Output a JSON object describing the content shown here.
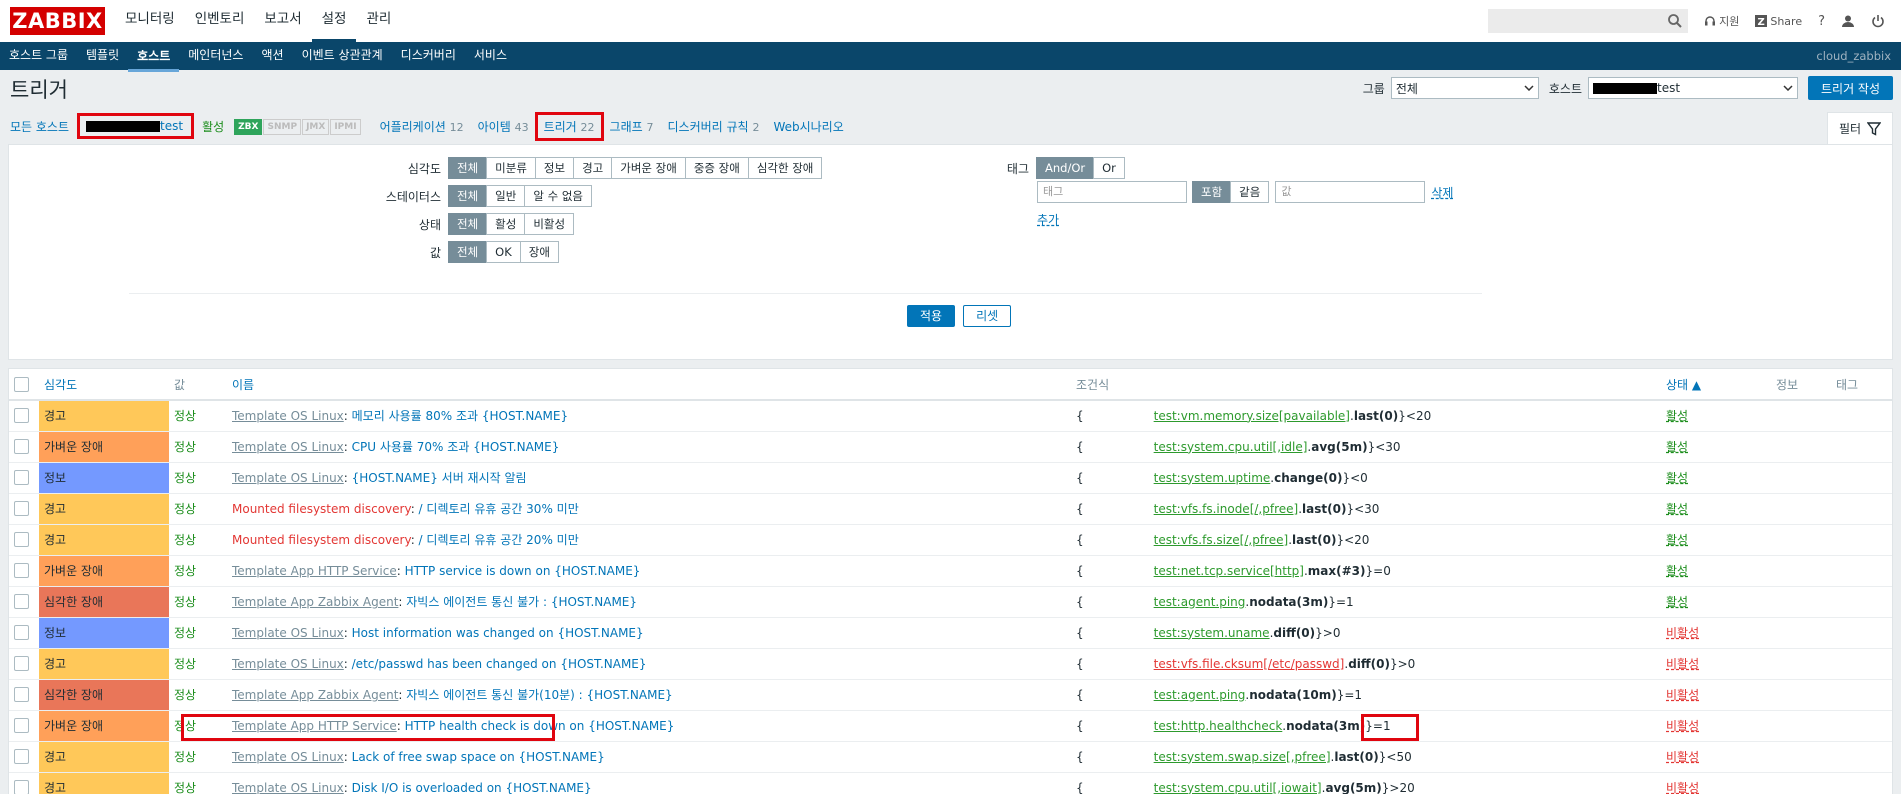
{
  "brand": {
    "logo_text": "ZABBIX",
    "color": "#d40000"
  },
  "main_menu": [
    "모니터링",
    "인벤토리",
    "보고서",
    "설정",
    "관리"
  ],
  "main_menu_active": "설정",
  "top_right": {
    "support": "지원",
    "share": "Share",
    "help": "?"
  },
  "sub_menu": [
    "호스트 그룹",
    "템플릿",
    "호스트",
    "메인터넌스",
    "액션",
    "이벤트 상관관계",
    "디스커버리",
    "서비스"
  ],
  "sub_menu_active": "호스트",
  "server_name": "cloud_zabbix",
  "page_title": "트리거",
  "header": {
    "group_label": "그룹",
    "group_value": "전체",
    "host_label": "호스트",
    "host_value_suffix": "test",
    "create_button": "트리거 작성"
  },
  "host_nav": {
    "all_hosts": "모든 호스트",
    "host_suffix": "test",
    "status": "활성",
    "interfaces": [
      "ZBX",
      "SNMP",
      "JMX",
      "IPMI"
    ],
    "apps": {
      "label": "어플리케이션",
      "count": "12"
    },
    "items": {
      "label": "아이템",
      "count": "43"
    },
    "triggers": {
      "label": "트리거",
      "count": "22"
    },
    "graphs": {
      "label": "그래프",
      "count": "7"
    },
    "discovery": {
      "label": "디스커버리 규칙",
      "count": "2"
    },
    "web": {
      "label": "Web시나리오"
    },
    "filter_tab": "필터"
  },
  "filter": {
    "severity_label": "심각도",
    "severity_options": [
      "전체",
      "미분류",
      "정보",
      "경고",
      "가벼운 장애",
      "중증 장애",
      "심각한 장애"
    ],
    "state_label": "스테이터스",
    "state_options": [
      "전체",
      "일반",
      "알 수 없음"
    ],
    "status_label": "상태",
    "status_options": [
      "전체",
      "활성",
      "비활성"
    ],
    "value_label": "값",
    "value_options": [
      "전체",
      "OK",
      "장애"
    ],
    "tags_label": "태그",
    "tags_ops": [
      "And/Or",
      "Or"
    ],
    "tag_placeholder": "태그",
    "tag_match": [
      "포함",
      "같음"
    ],
    "tag_value_placeholder": "값",
    "remove": "삭제",
    "add": "추가",
    "apply": "적용",
    "reset": "리셋"
  },
  "table": {
    "headers": {
      "severity": "심각도",
      "value": "값",
      "name": "이름",
      "expression": "조건식",
      "status": "상태 ▲",
      "info": "정보",
      "tags": "태그"
    },
    "rows": [
      {
        "sev": "경고",
        "cls": "s-warn",
        "value": "정상",
        "prefix": "Template OS Linux",
        "prefix_red": false,
        "name": "메모리 사용률 80% 조과 {HOST.NAME}",
        "exp_key": "test:vm.memory.size[pavailable]",
        "exp_fn": "last(0)",
        "exp_rest": "}<20",
        "exp_red": false,
        "status": "활성"
      },
      {
        "sev": "가벼운 장애",
        "cls": "s-avg",
        "value": "정상",
        "prefix": "Template OS Linux",
        "prefix_red": false,
        "name": "CPU 사용률 70% 조과 {HOST.NAME}",
        "exp_key": "test:system.cpu.util[,idle]",
        "exp_fn": "avg(5m)",
        "exp_rest": "}<30",
        "exp_red": false,
        "status": "활성"
      },
      {
        "sev": "정보",
        "cls": "s-info",
        "value": "정상",
        "prefix": "Template OS Linux",
        "prefix_red": false,
        "name": "{HOST.NAME} 서버 재시작 알림",
        "exp_key": "test:system.uptime",
        "exp_fn": "change(0)",
        "exp_rest": "}<0",
        "exp_red": false,
        "status": "활성"
      },
      {
        "sev": "경고",
        "cls": "s-warn",
        "value": "정상",
        "prefix": "Mounted filesystem discovery",
        "prefix_red": true,
        "name": "/ 디렉토리 유휴 공간 30% 미만",
        "exp_key": "test:vfs.fs.inode[/,pfree]",
        "exp_fn": "last(0)",
        "exp_rest": "}<30",
        "exp_red": false,
        "status": "활성"
      },
      {
        "sev": "경고",
        "cls": "s-warn",
        "value": "정상",
        "prefix": "Mounted filesystem discovery",
        "prefix_red": true,
        "name": "/ 디렉토리 유휴 공간 20% 미만",
        "exp_key": "test:vfs.fs.size[/,pfree]",
        "exp_fn": "last(0)",
        "exp_rest": "}<20",
        "exp_red": false,
        "status": "활성"
      },
      {
        "sev": "가벼운 장애",
        "cls": "s-avg",
        "value": "정상",
        "prefix": "Template App HTTP Service",
        "prefix_red": false,
        "name": "HTTP service is down on {HOST.NAME}",
        "exp_key": "test:net.tcp.service[http]",
        "exp_fn": "max(#3)",
        "exp_rest": "}=0",
        "exp_red": false,
        "status": "활성"
      },
      {
        "sev": "심각한 장애",
        "cls": "s-dis",
        "value": "정상",
        "prefix": "Template App Zabbix Agent",
        "prefix_red": false,
        "name": "자빅스 에이전트 통신 불가 : {HOST.NAME}",
        "exp_key": "test:agent.ping",
        "exp_fn": "nodata(3m)",
        "exp_rest": "}=1",
        "exp_red": false,
        "status": "활성"
      },
      {
        "sev": "정보",
        "cls": "s-info",
        "value": "정상",
        "prefix": "Template OS Linux",
        "prefix_red": false,
        "name": "Host information was changed on {HOST.NAME}",
        "exp_key": "test:system.uname",
        "exp_fn": "diff(0)",
        "exp_rest": "}>0",
        "exp_red": false,
        "status": "비활성"
      },
      {
        "sev": "경고",
        "cls": "s-warn",
        "value": "정상",
        "prefix": "Template OS Linux",
        "prefix_red": false,
        "name": "/etc/passwd has been changed on {HOST.NAME}",
        "exp_key": "test:vfs.file.cksum[/etc/passwd]",
        "exp_fn": "diff(0)",
        "exp_rest": "}>0",
        "exp_red": true,
        "status": "비활성"
      },
      {
        "sev": "심각한 장애",
        "cls": "s-dis",
        "value": "정상",
        "prefix": "Template App Zabbix Agent",
        "prefix_red": false,
        "name": "자빅스 에이전트 통신 불가(10분) : {HOST.NAME}",
        "exp_key": "test:agent.ping",
        "exp_fn": "nodata(10m)",
        "exp_rest": "}=1",
        "exp_red": false,
        "status": "비활성"
      },
      {
        "sev": "가벼운 장애",
        "cls": "s-avg",
        "value": "정상",
        "prefix": "Template App HTTP Service",
        "prefix_red": false,
        "name": "HTTP health check is down on {HOST.NAME}",
        "exp_key": "test:http.healthcheck",
        "exp_fn": "nodata(3m)",
        "exp_rest": "}=1",
        "exp_red": false,
        "status": "비활성",
        "highlight": true
      },
      {
        "sev": "경고",
        "cls": "s-warn",
        "value": "정상",
        "prefix": "Template OS Linux",
        "prefix_red": false,
        "name": "Lack of free swap space on {HOST.NAME}",
        "exp_key": "test:system.swap.size[,pfree]",
        "exp_fn": "last(0)",
        "exp_rest": "}<50",
        "exp_red": false,
        "status": "비활성"
      },
      {
        "sev": "경고",
        "cls": "s-warn",
        "value": "정상",
        "prefix": "Template OS Linux",
        "prefix_red": false,
        "name": "Disk I/O is overloaded on {HOST.NAME}",
        "exp_key": "test:system.cpu.util[,iowait]",
        "exp_fn": "avg(5m)",
        "exp_rest": "}>20",
        "exp_red": false,
        "status": "비활성"
      }
    ]
  }
}
